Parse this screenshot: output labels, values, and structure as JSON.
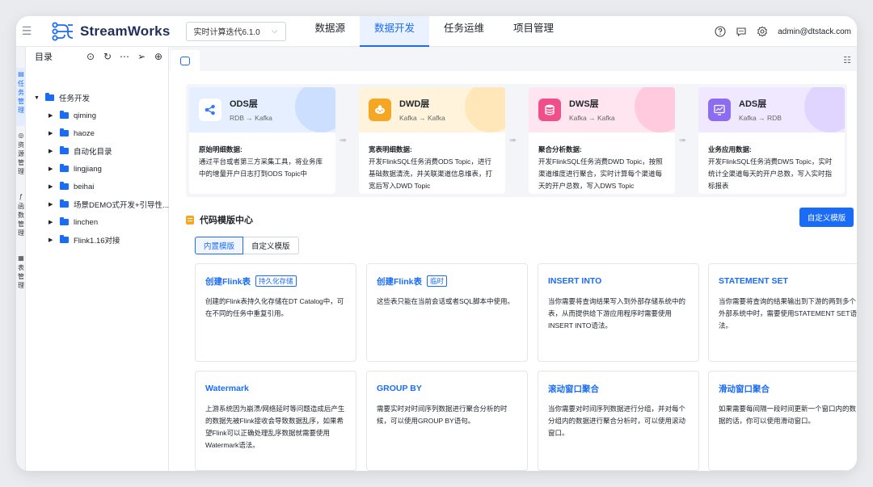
{
  "app": {
    "name": "StreamWorks",
    "version_select": "实时计算迭代6.1.0"
  },
  "nav": [
    "数据源",
    "数据开发",
    "任务运维",
    "项目管理"
  ],
  "nav_active": 1,
  "user": "admin@dtstack.com",
  "rail": [
    {
      "label": "任务管理",
      "icon": "task-icon"
    },
    {
      "label": "资源管理",
      "icon": "resource-icon"
    },
    {
      "label": "函数管理",
      "icon": "function-icon"
    },
    {
      "label": "表管理",
      "icon": "table-icon"
    }
  ],
  "tree": {
    "title": "目录",
    "root": "任务开发",
    "items": [
      "qiming",
      "haoze",
      "自动化目录",
      "lingjiang",
      "beihai",
      "场景DEMO式开发+引导性...",
      "linchen",
      "Flink1.16对接"
    ]
  },
  "layers": [
    {
      "name": "ODS层",
      "flow": "RDB → Kafka",
      "head": "原始明细数据:",
      "desc": "通过平台或者第三方采集工具，将业务库中的增量开户日志打到ODS Topic中",
      "color": "#e5efff",
      "accent": "#3d7bf5",
      "icon": "ods-icon"
    },
    {
      "name": "DWD层",
      "flow": "Kafka → Kafka",
      "head": "宽表明细数据:",
      "desc": "开发FlinkSQL任务消费ODS Topic，进行基础数据清洗，并关联渠道信息维表，打宽后写入DWD Topic",
      "color": "#fff3dc",
      "accent": "#f5a623",
      "icon": "dwd-icon"
    },
    {
      "name": "DWS层",
      "flow": "Kafka → Kafka",
      "head": "聚合分析数据:",
      "desc": "开发FlinkSQL任务消费DWD Topic，按照渠道维度进行聚合，实时计算每个渠道每天的开户总数，写入DWS Topic",
      "color": "#ffe5ef",
      "accent": "#f0508a",
      "icon": "dws-icon"
    },
    {
      "name": "ADS层",
      "flow": "Kafka → RDB",
      "head": "业务应用数据:",
      "desc": "开发FlinkSQL任务消费DWS Topic，实时统计全渠道每天的开户总数，写入实时指标报表",
      "color": "#efe8ff",
      "accent": "#8c6cf0",
      "icon": "ads-icon"
    }
  ],
  "templates": {
    "title": "代码模版中心",
    "custom_button": "自定义模版",
    "tabs": [
      "内置模版",
      "自定义模版"
    ],
    "cards": [
      {
        "title": "创建Flink表",
        "tag": "持久化存储",
        "desc": "创建的Flink表持久化存储在DT Catalog中，可在不同的任务中重复引用。"
      },
      {
        "title": "创建Flink表",
        "tag": "临时",
        "desc": "这些表只能在当前会话或者SQL脚本中使用。"
      },
      {
        "title": "INSERT INTO",
        "tag": "",
        "desc": "当你需要将查询结果写入到外部存储系统中的表，从而提供给下游应用程序时需要使用INSERT INTO语法。"
      },
      {
        "title": "STATEMENT SET",
        "tag": "",
        "desc": "当你需要将查询的结果输出到下游的两到多个外部系统中时，需要使用STATEMENT SET语法。"
      },
      {
        "title": "Watermark",
        "tag": "",
        "desc": "上游系统因为崩溃/网络延时等问题造成后产生的数据先被Flink接收会导致数据乱序，如果希望Flink可以正确处理乱序数据就需要使用Watermark语法。"
      },
      {
        "title": "GROUP BY",
        "tag": "",
        "desc": "需要实时对时间序列数据进行聚合分析的时候，可以使用GROUP BY语句。"
      },
      {
        "title": "滚动窗口聚合",
        "tag": "",
        "desc": "当你需要对时间序列数据进行分组，并对每个分组内的数据进行聚合分析时，可以使用滚动窗口。"
      },
      {
        "title": "滑动窗口聚合",
        "tag": "",
        "desc": "如果需要每间隔一段时间更新一个窗口内的数据的话，你可以使用滑动窗口。"
      }
    ]
  }
}
